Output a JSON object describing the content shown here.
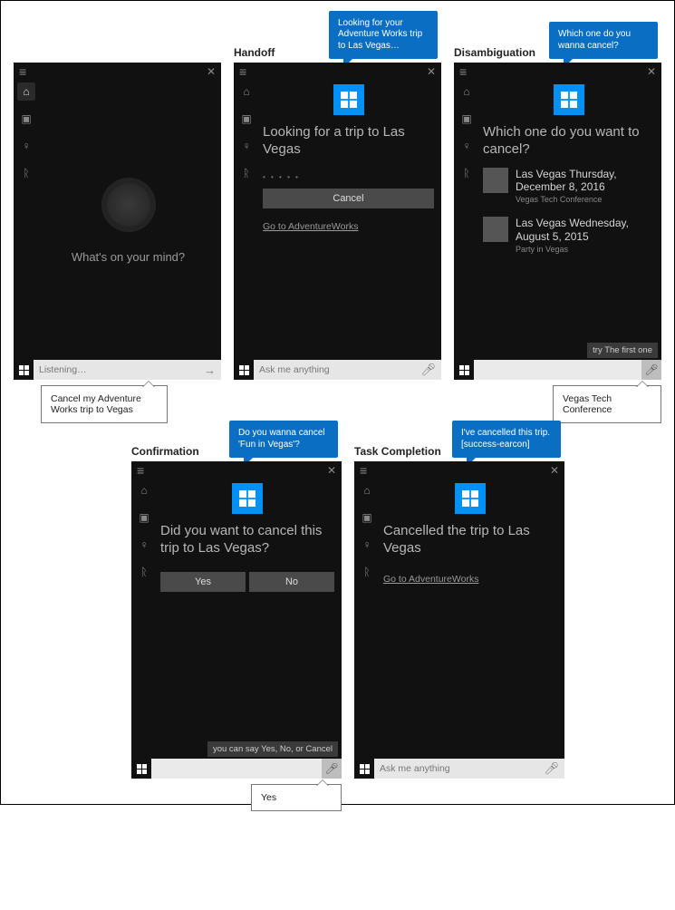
{
  "section_titles": {
    "handoff": "Handoff",
    "disambig": "Disambiguation",
    "confirm": "Confirmation",
    "complete": "Task Completion"
  },
  "bubbles": {
    "handoff": "Looking for your Adventure Works trip to Las Vegas…",
    "disambig": "Which one do you wanna cancel?",
    "confirm": "Do you wanna cancel 'Fun in Vegas'?",
    "complete": "I've cancelled this trip. [success-earcon]"
  },
  "callouts": {
    "p1": "Cancel my Adventure Works trip to Vegas",
    "p3": "Vegas Tech Conference",
    "p4": "Yes"
  },
  "panel1": {
    "prompt": "What's on your mind?",
    "search": "Listening…"
  },
  "panel2": {
    "heading": "Looking for a trip to Las Vegas",
    "cancel": "Cancel",
    "link": "Go to AdventureWorks",
    "search": "Ask me anything"
  },
  "panel3": {
    "heading": "Which one do you want to cancel?",
    "items": [
      {
        "title": "Las Vegas Thursday, December 8, 2016",
        "sub": "Vegas Tech Conference"
      },
      {
        "title": "Las Vegas Wednesday, August 5, 2015",
        "sub": "Party in Vegas"
      }
    ],
    "hint": "try The first one",
    "search": ""
  },
  "panel4": {
    "heading": "Did you want to cancel this trip to Las Vegas?",
    "yes": "Yes",
    "no": "No",
    "hint": "you can say Yes, No, or Cancel",
    "search": ""
  },
  "panel5": {
    "heading": "Cancelled the trip to Las Vegas",
    "link": "Go to AdventureWorks",
    "search": "Ask me anything"
  }
}
